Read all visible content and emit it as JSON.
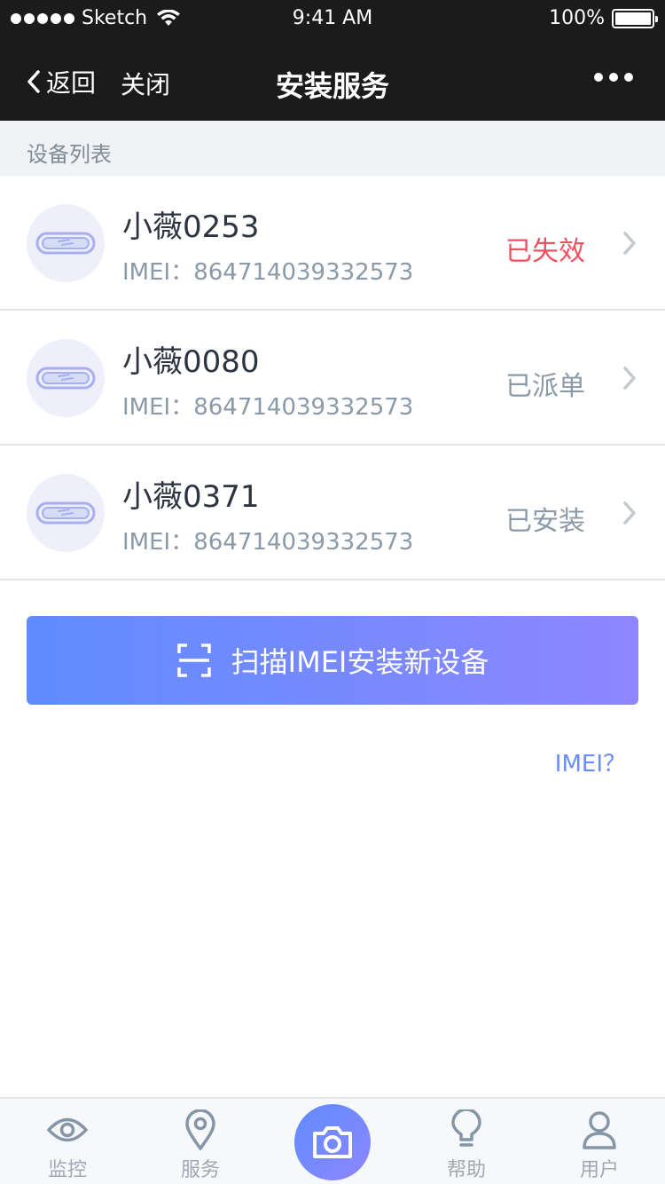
{
  "status_bar": {
    "carrier": "Sketch",
    "time": "9:41 AM",
    "battery": "100%"
  },
  "nav": {
    "back_label": "返回",
    "close_label": "关闭",
    "title": "安装服务",
    "more_icon": "more-icon"
  },
  "section": {
    "title": "设备列表"
  },
  "devices": [
    {
      "name": "小薇0253",
      "imei": "IMEI：864714039332573",
      "status": "已失效",
      "status_color": "#f0505f"
    },
    {
      "name": "小薇0080",
      "imei": "IMEI：864714039332573",
      "status": "已派单",
      "status_color": "#8a9aa8"
    },
    {
      "name": "小薇0371",
      "imei": "IMEI：864714039332573",
      "status": "已安装",
      "status_color": "#8a9aa8"
    }
  ],
  "scan_button": {
    "label": "扫描IMEI安装新设备",
    "icon": "scan-icon"
  },
  "imei_help": {
    "label": "IMEI？"
  },
  "tabs": [
    {
      "label": "监控",
      "icon": "eye-icon"
    },
    {
      "label": "服务",
      "icon": "location-pin-icon"
    },
    {
      "label": "",
      "icon": "camera-icon"
    },
    {
      "label": "帮助",
      "icon": "lightbulb-icon"
    },
    {
      "label": "用户",
      "icon": "user-icon"
    }
  ],
  "colors": {
    "accent_start": "#5f8cff",
    "accent_end": "#8e86ff",
    "expired": "#f0505f",
    "nav_bg": "#1b1b1b"
  }
}
